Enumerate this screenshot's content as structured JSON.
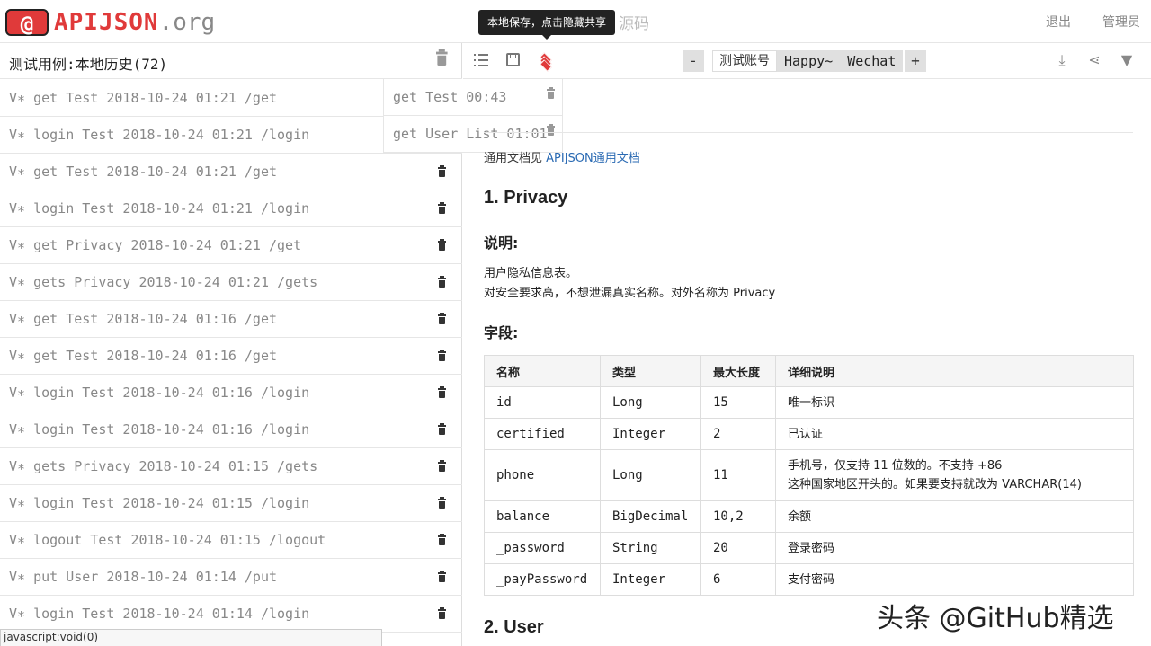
{
  "topbar": {
    "logo_badge": "@",
    "logo_name": "APIJSON",
    "logo_org": ".org",
    "source_link": "源码",
    "logout": "退出",
    "admin": "管理员"
  },
  "left": {
    "title": "测试用例:本地历史(72)",
    "history": [
      "V∗ get Test 2018-10-24 01:21 /get",
      "V∗ login Test 2018-10-24 01:21 /login",
      "V∗ get Test 2018-10-24 01:21 /get",
      "V∗ login Test 2018-10-24 01:21 /login",
      "V∗ get Privacy 2018-10-24 01:21 /get",
      "V∗ gets Privacy 2018-10-24 01:21 /gets",
      "V∗ get Test 2018-10-24 01:16 /get",
      "V∗ get Test 2018-10-24 01:16 /get",
      "V∗ login Test 2018-10-24 01:16 /login",
      "V∗ login Test 2018-10-24 01:16 /login",
      "V∗ gets Privacy 2018-10-24 01:15 /gets",
      "V∗ login Test 2018-10-24 01:15 /login",
      "V∗ logout Test 2018-10-24 01:15 /logout",
      "V∗ put User 2018-10-24 01:14 /put",
      "V∗ login Test 2018-10-24 01:14 /login"
    ]
  },
  "popup": {
    "items": [
      "get Test 00:43",
      "get User List 01:01"
    ]
  },
  "status": "javascript:void(0)",
  "toolbar": {
    "tooltip": "本地保存，点击隐藏共享",
    "minus": "-",
    "plus": "+",
    "account_label": "测试账号",
    "accounts": [
      "Happy~",
      "Wechat"
    ]
  },
  "doc": {
    "note_prefix": "通用文档见",
    "note_link": "APIJSON通用文档",
    "section1_title": "1. Privacy",
    "desc_heading": "说明:",
    "desc_line1": "用户隐私信息表。",
    "desc_line2": "对安全要求高，不想泄漏真实名称。对外名称为 Privacy",
    "fields_heading": "字段:",
    "table_headers": [
      "名称",
      "类型",
      "最大长度",
      "详细说明"
    ],
    "table_rows": [
      {
        "name": "id",
        "type": "Long",
        "len": "15",
        "desc1": "唯一标识",
        "desc2": ""
      },
      {
        "name": "certified",
        "type": "Integer",
        "len": "2",
        "desc1": "已认证",
        "desc2": ""
      },
      {
        "name": "phone",
        "type": "Long",
        "len": "11",
        "desc1": "手机号，仅支持 11 位数的。不支持 +86",
        "desc2": "这种国家地区开头的。如果要支持就改为 VARCHAR(14)"
      },
      {
        "name": "balance",
        "type": "BigDecimal",
        "len": "10,2",
        "desc1": "余额",
        "desc2": ""
      },
      {
        "name": "_password",
        "type": "String",
        "len": "20",
        "desc1": "登录密码",
        "desc2": ""
      },
      {
        "name": "_payPassword",
        "type": "Integer",
        "len": "6",
        "desc1": "支付密码",
        "desc2": ""
      }
    ],
    "section2_title": "2. User"
  },
  "watermark": "头条 @GitHub精选"
}
